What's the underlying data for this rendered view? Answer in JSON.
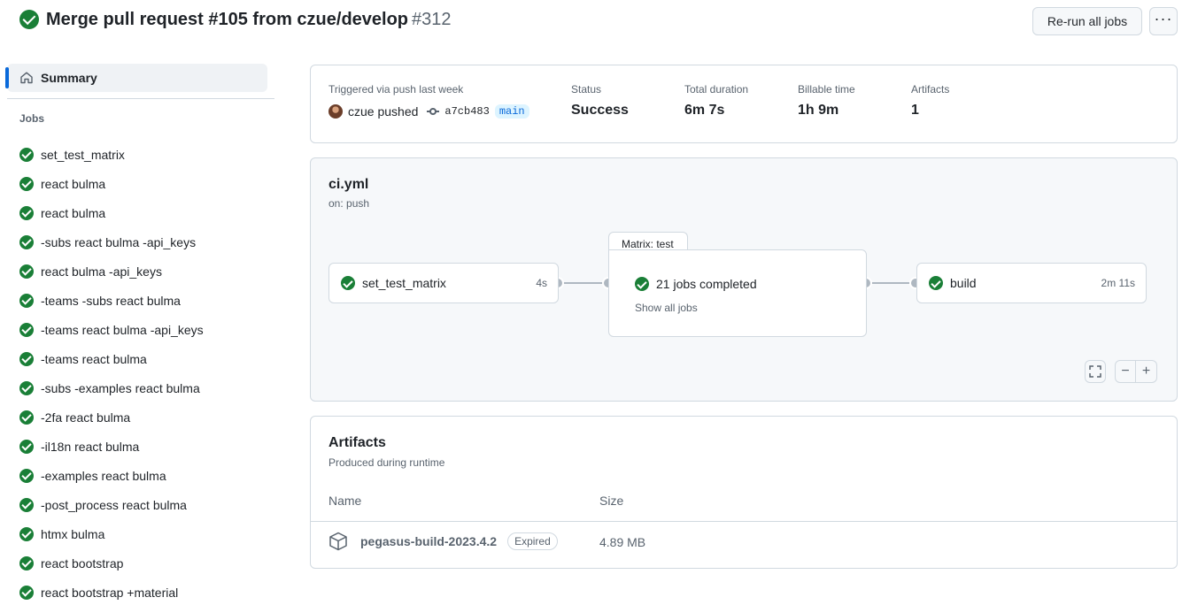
{
  "header": {
    "title": "Merge pull request #105 from czue/develop",
    "run_number": "#312",
    "rerun_label": "Re-run all jobs",
    "more_label": "···"
  },
  "sidebar": {
    "summary_label": "Summary",
    "jobs_heading": "Jobs",
    "jobs": [
      "set_test_matrix",
      "react bulma",
      "react bulma",
      "-subs react bulma -api_keys",
      "react bulma -api_keys",
      "-teams -subs react bulma",
      "-teams react bulma -api_keys",
      "-teams react bulma",
      "-subs -examples react bulma",
      "-2fa react bulma",
      "-il18n react bulma",
      "-examples react bulma",
      "-post_process react bulma",
      "htmx bulma",
      "react bootstrap",
      "react bootstrap +material"
    ]
  },
  "run_info": {
    "trigger_label": "Triggered via push last week",
    "actor": "czue pushed",
    "commit_sha": "a7cb483",
    "branch": "main",
    "status_label": "Status",
    "status_value": "Success",
    "duration_label": "Total duration",
    "duration_value": "6m 7s",
    "billable_label": "Billable time",
    "billable_value": "1h 9m",
    "artifacts_label": "Artifacts",
    "artifacts_value": "1"
  },
  "workflow": {
    "name": "ci.yml",
    "trigger": "on: push",
    "job1_name": "set_test_matrix",
    "job1_duration": "4s",
    "matrix_label": "Matrix: test",
    "matrix_status": "21 jobs completed",
    "matrix_link": "Show all jobs",
    "job3_name": "build",
    "job3_duration": "2m 11s",
    "zoom_out": "−",
    "zoom_in": "+"
  },
  "artifacts": {
    "title": "Artifacts",
    "subtitle": "Produced during runtime",
    "col_name": "Name",
    "col_size": "Size",
    "item_name": "pegasus-build-2023.4.2",
    "item_status": "Expired",
    "item_size": "4.89 MB"
  },
  "colors": {
    "success": "#1a7f37",
    "accent": "#0969da",
    "muted": "#59636e"
  }
}
